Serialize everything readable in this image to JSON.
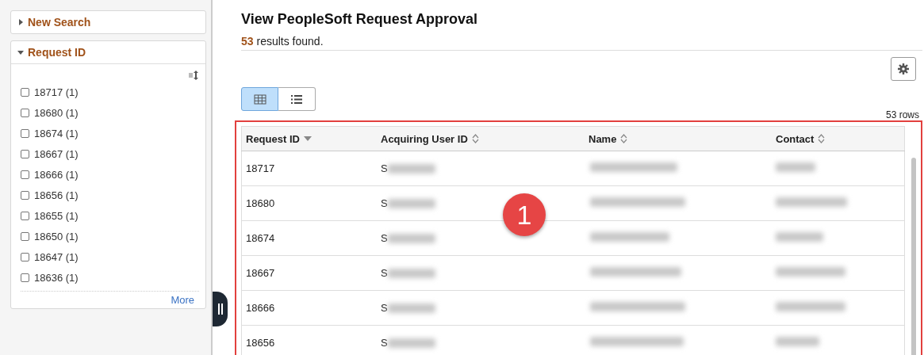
{
  "sidebar": {
    "panels": [
      {
        "title": "New Search",
        "expanded": false
      },
      {
        "title": "Request ID",
        "expanded": true
      }
    ],
    "filter_items": [
      {
        "label": "18717 (1)",
        "checked": false
      },
      {
        "label": "18680 (1)",
        "checked": false
      },
      {
        "label": "18674 (1)",
        "checked": false
      },
      {
        "label": "18667 (1)",
        "checked": false
      },
      {
        "label": "18666 (1)",
        "checked": false
      },
      {
        "label": "18656 (1)",
        "checked": false
      },
      {
        "label": "18655 (1)",
        "checked": false
      },
      {
        "label": "18650 (1)",
        "checked": false
      },
      {
        "label": "18647 (1)",
        "checked": false
      },
      {
        "label": "18636 (1)",
        "checked": false
      }
    ],
    "more_link": "More"
  },
  "page_title": "View PeopleSoft Request Approval",
  "results": {
    "count": "53",
    "text": " results found."
  },
  "view_toggle": [
    {
      "kind": "grid",
      "selected": true
    },
    {
      "kind": "list",
      "selected": false
    }
  ],
  "row_count": "53 rows",
  "table": {
    "columns": [
      {
        "label": "Request ID",
        "sorted": true
      },
      {
        "label": "Acquiring User ID",
        "sorted": false
      },
      {
        "label": "Name",
        "sorted": false
      },
      {
        "label": "Contact",
        "sorted": false
      }
    ],
    "rows": [
      {
        "request_id": "18717",
        "user_id": "S"
      },
      {
        "request_id": "18680",
        "user_id": "S"
      },
      {
        "request_id": "18674",
        "user_id": "S"
      },
      {
        "request_id": "18667",
        "user_id": "S"
      },
      {
        "request_id": "18666",
        "user_id": "S"
      },
      {
        "request_id": "18656",
        "user_id": "S"
      }
    ]
  },
  "callout": "1"
}
